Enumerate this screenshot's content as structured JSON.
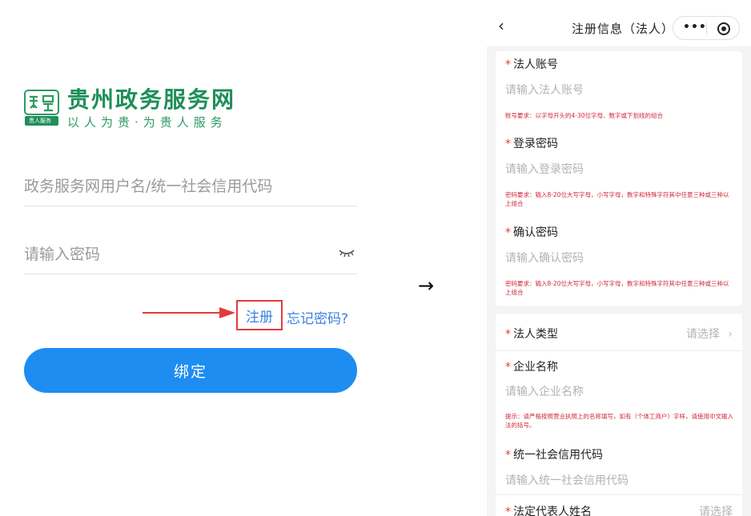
{
  "left": {
    "logo": {
      "title": "贵州政务服务网",
      "subtitle": "以人为贵·为贵人服务",
      "badge": "贵人服务"
    },
    "username_placeholder": "政务服务网用户名/统一社会信用代码",
    "password_placeholder": "请输入密码",
    "register_label": "注册",
    "forgot_label": "忘记密码?",
    "bind_button_label": "绑定"
  },
  "flow_arrow": "→",
  "right": {
    "nav": {
      "back_icon": "‹",
      "title": "注册信息（法人）",
      "more_icon": "•••"
    },
    "required_mark": "*",
    "fields": {
      "account": {
        "label": "法人账号",
        "placeholder": "请输入法人账号",
        "hint": "账号要求：以字母开头的4-30位字母、数字或下划线的组合"
      },
      "password": {
        "label": "登录密码",
        "placeholder": "请输入登录密码",
        "hint": "密码要求：输入8-20位大写字母，小写字母，数字和特殊字符其中任意三种或三种以上组合"
      },
      "confirm_password": {
        "label": "确认密码",
        "placeholder": "请输入确认密码",
        "hint": "密码要求：输入8-20位大写字母，小写字母，数字和特殊字符其中任意三种或三种以上组合"
      },
      "legal_type": {
        "label": "法人类型",
        "value": "请选择",
        "chevron": "›"
      },
      "company_name": {
        "label": "企业名称",
        "placeholder": "请输入企业名称",
        "hint": "提示：请严格按照营业执照上的名称填写，如有（个体工商户）字样，请使用中文输入法的括号。"
      },
      "credit_code": {
        "label": "统一社会信用代码",
        "placeholder": "请输入统一社会信用代码"
      },
      "representative_name": {
        "label": "法定代表人姓名",
        "value": "请选择"
      }
    }
  },
  "colors": {
    "brand_green": "#1f8f5a",
    "primary_blue": "#1e8df1",
    "link_blue": "#3b7fe3",
    "highlight_red": "#e33b3b",
    "hint_red": "#d0263a"
  }
}
